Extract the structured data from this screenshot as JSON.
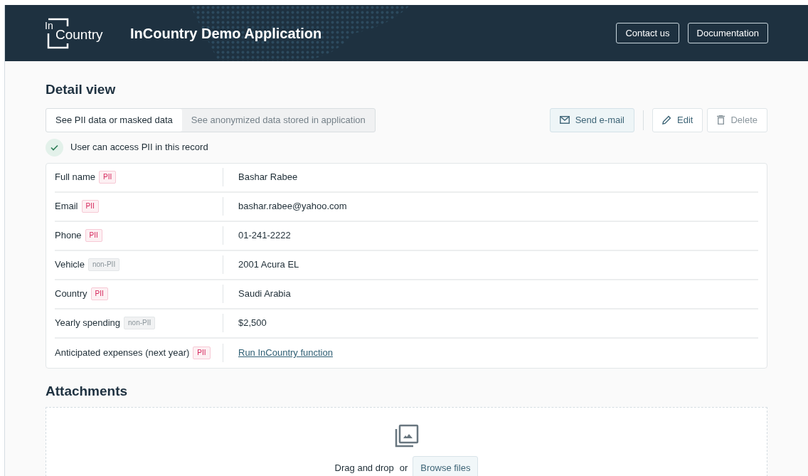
{
  "header": {
    "logo_small": "In",
    "logo_text": "Country",
    "title": "InCountry Demo Application",
    "buttons": [
      "Contact us",
      "Documentation"
    ]
  },
  "detail": {
    "heading": "Detail view",
    "tabs": [
      {
        "label": "See PII data or masked data",
        "selected": true
      },
      {
        "label": "See anonymized data stored in application",
        "selected": false
      }
    ],
    "actions": [
      {
        "label": "Send e-mail",
        "kind": "email",
        "disabled": false
      },
      {
        "label": "Edit",
        "kind": "edit",
        "disabled": false
      },
      {
        "label": "Delete",
        "kind": "delete",
        "disabled": true
      }
    ],
    "access_notice": "User can access PII in this record",
    "rows": [
      {
        "label": "Full name",
        "tag": {
          "label": "PII",
          "kind": "pii"
        },
        "value": "Bashar Rabee",
        "kind": "text"
      },
      {
        "label": "Email",
        "tag": {
          "label": "PII",
          "kind": "pii"
        },
        "value": "bashar.rabee@yahoo.com",
        "kind": "text"
      },
      {
        "label": "Phone",
        "tag": {
          "label": "PII",
          "kind": "pii"
        },
        "value": "01-241-2222",
        "kind": "text"
      },
      {
        "label": "Vehicle",
        "tag": {
          "label": "non-PII",
          "kind": "non_pii"
        },
        "value": "2001 Acura EL",
        "kind": "text"
      },
      {
        "label": "Country",
        "tag": {
          "label": "PII",
          "kind": "pii"
        },
        "value": "Saudi Arabia",
        "kind": "text"
      },
      {
        "label": "Yearly spending",
        "tag": {
          "label": "non-PII",
          "kind": "non_pii"
        },
        "value": "$2,500",
        "kind": "text"
      },
      {
        "label": "Anticipated expenses (next year)",
        "tag": {
          "label": "PII",
          "kind": "pii"
        },
        "value": "Run InCountry function",
        "kind": "link"
      }
    ]
  },
  "attachments": {
    "heading": "Attachments",
    "drop_text": "Drag and drop",
    "or_text": "or",
    "browse_button": "Browse files"
  }
}
